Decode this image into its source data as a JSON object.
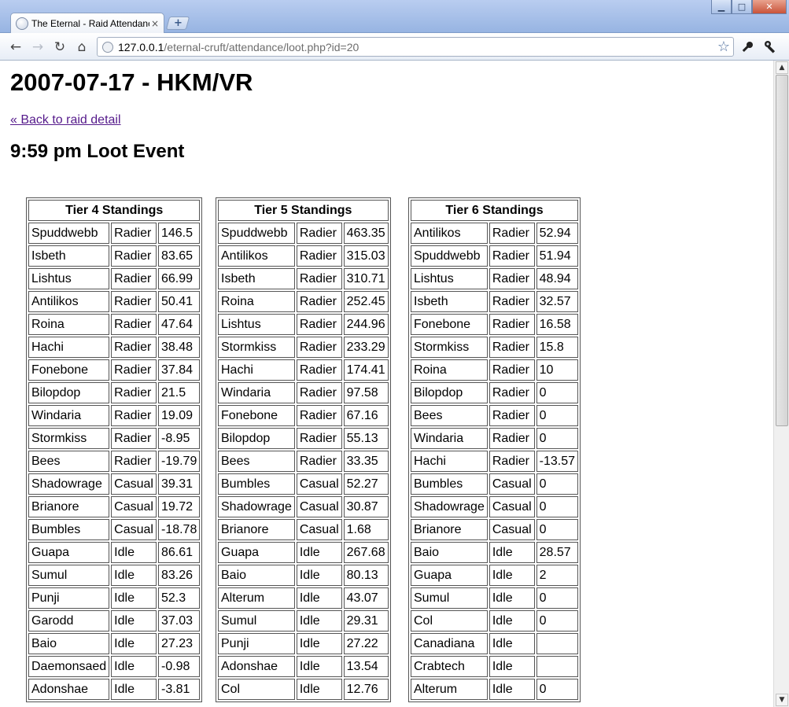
{
  "browser": {
    "tab_title": "The Eternal - Raid Attendance",
    "tab_close": "×",
    "new_tab": "+",
    "url_host": "127.0.0.1",
    "url_rest": "/eternal-cruft/attendance/loot.php?id=20",
    "window_controls": {
      "minimize": "▁",
      "maximize": "□",
      "close": "✕"
    },
    "nav": {
      "back": "←",
      "forward": "→",
      "reload": "↻",
      "home": "⌂",
      "star": "☆",
      "page": "🔧",
      "wrench": "🔧"
    }
  },
  "page": {
    "title": "2007-07-17 - HKM/VR",
    "back_link": "« Back to raid detail",
    "event_heading": "9:59 pm Loot Event"
  },
  "tables": [
    {
      "header": "Tier 4 Standings",
      "rows": [
        [
          "Spuddwebb",
          "Radier",
          "146.5"
        ],
        [
          "Isbeth",
          "Radier",
          "83.65"
        ],
        [
          "Lishtus",
          "Radier",
          "66.99"
        ],
        [
          "Antilikos",
          "Radier",
          "50.41"
        ],
        [
          "Roina",
          "Radier",
          "47.64"
        ],
        [
          "Hachi",
          "Radier",
          "38.48"
        ],
        [
          "Fonebone",
          "Radier",
          "37.84"
        ],
        [
          "Bilopdop",
          "Radier",
          "21.5"
        ],
        [
          "Windaria",
          "Radier",
          "19.09"
        ],
        [
          "Stormkiss",
          "Radier",
          "-8.95"
        ],
        [
          "Bees",
          "Radier",
          "-19.79"
        ],
        [
          "Shadowrage",
          "Casual",
          "39.31"
        ],
        [
          "Brianore",
          "Casual",
          "19.72"
        ],
        [
          "Bumbles",
          "Casual",
          "-18.78"
        ],
        [
          "Guapa",
          "Idle",
          "86.61"
        ],
        [
          "Sumul",
          "Idle",
          "83.26"
        ],
        [
          "Punji",
          "Idle",
          "52.3"
        ],
        [
          "Garodd",
          "Idle",
          "37.03"
        ],
        [
          "Baio",
          "Idle",
          "27.23"
        ],
        [
          "Daemonsaed",
          "Idle",
          "-0.98"
        ],
        [
          "Adonshae",
          "Idle",
          "-3.81"
        ]
      ]
    },
    {
      "header": "Tier 5 Standings",
      "rows": [
        [
          "Spuddwebb",
          "Radier",
          "463.35"
        ],
        [
          "Antilikos",
          "Radier",
          "315.03"
        ],
        [
          "Isbeth",
          "Radier",
          "310.71"
        ],
        [
          "Roina",
          "Radier",
          "252.45"
        ],
        [
          "Lishtus",
          "Radier",
          "244.96"
        ],
        [
          "Stormkiss",
          "Radier",
          "233.29"
        ],
        [
          "Hachi",
          "Radier",
          "174.41"
        ],
        [
          "Windaria",
          "Radier",
          "97.58"
        ],
        [
          "Fonebone",
          "Radier",
          "67.16"
        ],
        [
          "Bilopdop",
          "Radier",
          "55.13"
        ],
        [
          "Bees",
          "Radier",
          "33.35"
        ],
        [
          "Bumbles",
          "Casual",
          "52.27"
        ],
        [
          "Shadowrage",
          "Casual",
          "30.87"
        ],
        [
          "Brianore",
          "Casual",
          "1.68"
        ],
        [
          "Guapa",
          "Idle",
          "267.68"
        ],
        [
          "Baio",
          "Idle",
          "80.13"
        ],
        [
          "Alterum",
          "Idle",
          "43.07"
        ],
        [
          "Sumul",
          "Idle",
          "29.31"
        ],
        [
          "Punji",
          "Idle",
          "27.22"
        ],
        [
          "Adonshae",
          "Idle",
          "13.54"
        ],
        [
          "Col",
          "Idle",
          "12.76"
        ]
      ]
    },
    {
      "header": "Tier 6 Standings",
      "rows": [
        [
          "Antilikos",
          "Radier",
          "52.94"
        ],
        [
          "Spuddwebb",
          "Radier",
          "51.94"
        ],
        [
          "Lishtus",
          "Radier",
          "48.94"
        ],
        [
          "Isbeth",
          "Radier",
          "32.57"
        ],
        [
          "Fonebone",
          "Radier",
          "16.58"
        ],
        [
          "Stormkiss",
          "Radier",
          "15.8"
        ],
        [
          "Roina",
          "Radier",
          "10"
        ],
        [
          "Bilopdop",
          "Radier",
          "0"
        ],
        [
          "Bees",
          "Radier",
          "0"
        ],
        [
          "Windaria",
          "Radier",
          "0"
        ],
        [
          "Hachi",
          "Radier",
          "-13.57"
        ],
        [
          "Bumbles",
          "Casual",
          "0"
        ],
        [
          "Shadowrage",
          "Casual",
          "0"
        ],
        [
          "Brianore",
          "Casual",
          "0"
        ],
        [
          "Baio",
          "Idle",
          "28.57"
        ],
        [
          "Guapa",
          "Idle",
          "2"
        ],
        [
          "Sumul",
          "Idle",
          "0"
        ],
        [
          "Col",
          "Idle",
          "0"
        ],
        [
          "Canadiana",
          "Idle",
          ""
        ],
        [
          "Crabtech",
          "Idle",
          ""
        ],
        [
          "Alterum",
          "Idle",
          "0"
        ]
      ]
    }
  ]
}
